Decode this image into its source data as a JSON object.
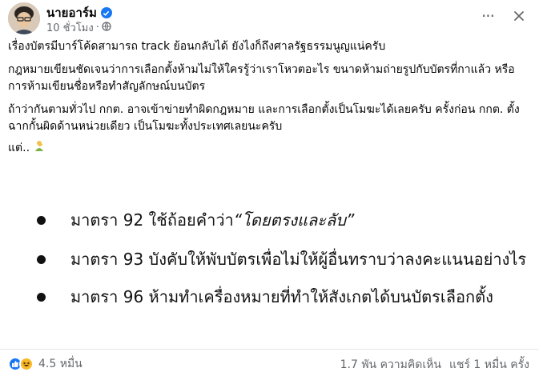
{
  "post": {
    "author": "นายอาร์ม",
    "time": "10 ชั่วโมง",
    "verified_icon": "verified-badge-icon",
    "paragraphs": {
      "p1": "เรื่องบัตรมีบาร์โค้ดสามารถ track ย้อนกลับได้ ยังไงก็ถึงศาลรัฐธรรมนูญแน่ครับ",
      "p2": "กฎหมายเขียนชัดเจนว่าการเลือกตั้งห้ามไม่ให้ใครรู้ว่าเราโหวตอะไร ขนาดห้ามถ่ายรูปกับบัตรที่กาแล้ว หรือการห้ามเขียนชื่อหรือทำสัญลักษณ์บนบัตร",
      "p3": "ถ้าว่ากันตามทั่วไป กกต. อาจเข้าข่ายทำผิดกฎหมาย และการเลือกตั้งเป็นโมฆะได้เลยครับ ครั้งก่อน กกต. ตั้งฉากกั้นผิดด้านหน่วยเดียว เป็นโมฆะทั้งประเทศเลยนะครับ",
      "p4": "แต่.."
    }
  },
  "image": {
    "items": [
      {
        "text": "มาตรา 92 ใช้ถ้อยคำว่า ",
        "emphasis": "“โดยตรงและลับ”"
      },
      {
        "text": "มาตรา 93 บังคับให้พับบัตรเพื่อไม่ให้ผู้อื่นทราบว่าลงคะแนนอย่างไร"
      },
      {
        "text": "มาตรา 96  ห้ามทำเครื่องหมายที่ทำให้สังเกตได้บนบัตรเลือกตั้ง"
      }
    ]
  },
  "footer": {
    "reaction_count": "4.5 หมื่น",
    "comments": "1.7 พัน ความคิดเห็น",
    "shares": "แชร์ 1 หมื่น ครั้ง"
  },
  "colors": {
    "accent": "#1877f2",
    "secondary_text": "#65676b"
  }
}
